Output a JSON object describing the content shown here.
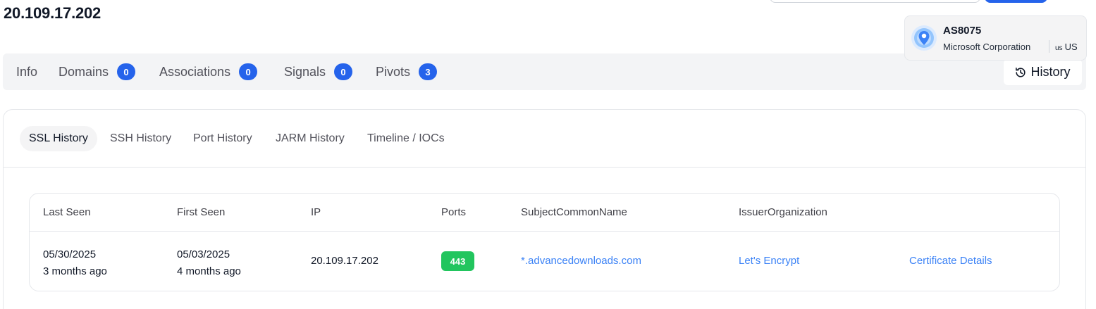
{
  "page": {
    "title": "20.109.17.202"
  },
  "asn": {
    "number": "AS8075",
    "organization": "Microsoft Corporation",
    "country_flag": "us",
    "country_code": "US"
  },
  "tabs": [
    {
      "label": "Info"
    },
    {
      "label": "Domains",
      "count": "0"
    },
    {
      "label": "Associations",
      "count": "0"
    },
    {
      "label": "Signals",
      "count": "0"
    },
    {
      "label": "Pivots",
      "count": "3"
    }
  ],
  "history_button": {
    "label": "History",
    "icon": "history-icon"
  },
  "subtabs": [
    {
      "label": "SSL History",
      "active": true
    },
    {
      "label": "SSH History"
    },
    {
      "label": "Port History"
    },
    {
      "label": "JARM History"
    },
    {
      "label": "Timeline / IOCs"
    }
  ],
  "table": {
    "columns": [
      "Last Seen",
      "First Seen",
      "IP",
      "Ports",
      "SubjectCommonName",
      "IssuerOrganization"
    ],
    "rows": [
      {
        "last_seen": "05/30/2025",
        "last_seen_relative": "3 months ago",
        "first_seen": "05/03/2025",
        "first_seen_relative": "4 months ago",
        "ip": "20.109.17.202",
        "port": "443",
        "subject_common_name": "*.advancedownloads.com",
        "issuer_organization": "Let's Encrypt",
        "details_link": "Certificate Details"
      }
    ]
  },
  "colors": {
    "accent": "#2563eb",
    "link": "#3b82f6",
    "port_badge": "#22c55e"
  }
}
